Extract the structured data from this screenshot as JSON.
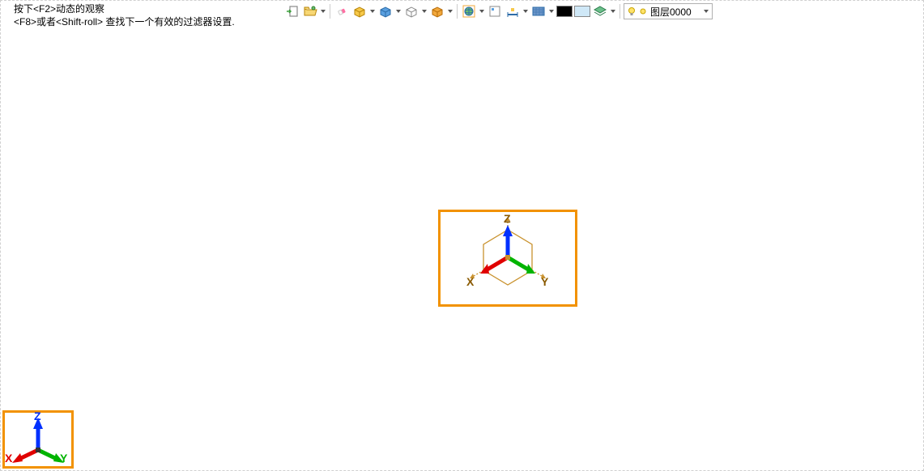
{
  "hints": {
    "line1": "按下<F2>动态的观察",
    "line2": "<F8>或者<Shift-roll> 查找下一个有效的过滤器设置."
  },
  "toolbar": {
    "icons": [
      "export-icon",
      "folder-open-icon",
      "eraser-icon",
      "package-icon",
      "cube-blue-icon",
      "cube-wire-icon",
      "cube-gold-icon",
      "globe-icon",
      "page-icon",
      "dimension-icon",
      "grid-icon",
      "swatch-black",
      "swatch-lightblue",
      "layers-icon"
    ]
  },
  "colors": {
    "black": "#000000",
    "lightblue": "#cfe8f7"
  },
  "layer": {
    "label": "图层0000"
  },
  "axes": {
    "x": "X",
    "y": "Y",
    "z": "Z"
  }
}
